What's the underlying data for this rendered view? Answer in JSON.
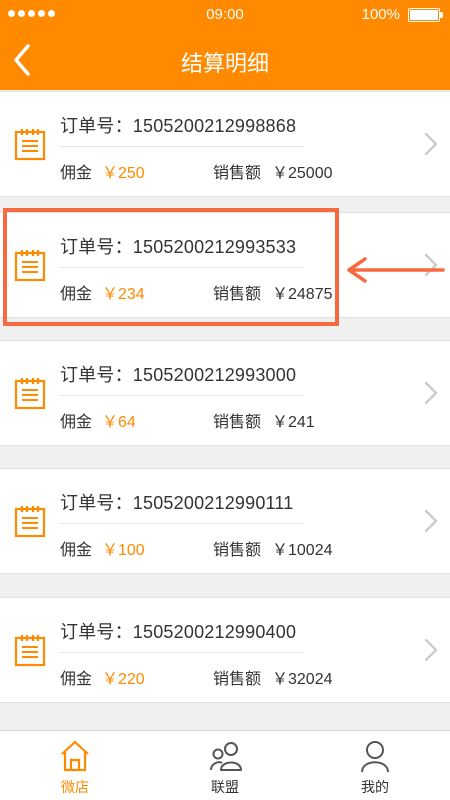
{
  "status_bar": {
    "time": "09:00",
    "battery": "100%"
  },
  "nav": {
    "title": "结算明细",
    "back_icon": "chevron-left-icon"
  },
  "orders": [
    {
      "order_label": "订单号：1505200212998868",
      "commission_label": "佣金",
      "commission": "￥250",
      "sales_label": "销售额",
      "sales": "￥25000"
    },
    {
      "order_label": "订单号：1505200212993533",
      "commission_label": "佣金",
      "commission": "￥234",
      "sales_label": "销售额",
      "sales": "￥24875"
    },
    {
      "order_label": "订单号：1505200212993000",
      "commission_label": "佣金",
      "commission": "￥64",
      "sales_label": "销售额",
      "sales": "￥241"
    },
    {
      "order_label": "订单号：1505200212990111",
      "commission_label": "佣金",
      "commission": "￥100",
      "sales_label": "销售额",
      "sales": "￥10024"
    },
    {
      "order_label": "订单号：1505200212990400",
      "commission_label": "佣金",
      "commission": "￥220",
      "sales_label": "销售额",
      "sales": "￥32024"
    }
  ],
  "tabs": [
    {
      "label": "微店",
      "icon": "home-icon",
      "active": true
    },
    {
      "label": "联盟",
      "icon": "group-icon",
      "active": false
    },
    {
      "label": "我的",
      "icon": "user-icon",
      "active": false
    }
  ],
  "colors": {
    "accent": "#ff8a00",
    "annotation": "#f56a3f"
  }
}
